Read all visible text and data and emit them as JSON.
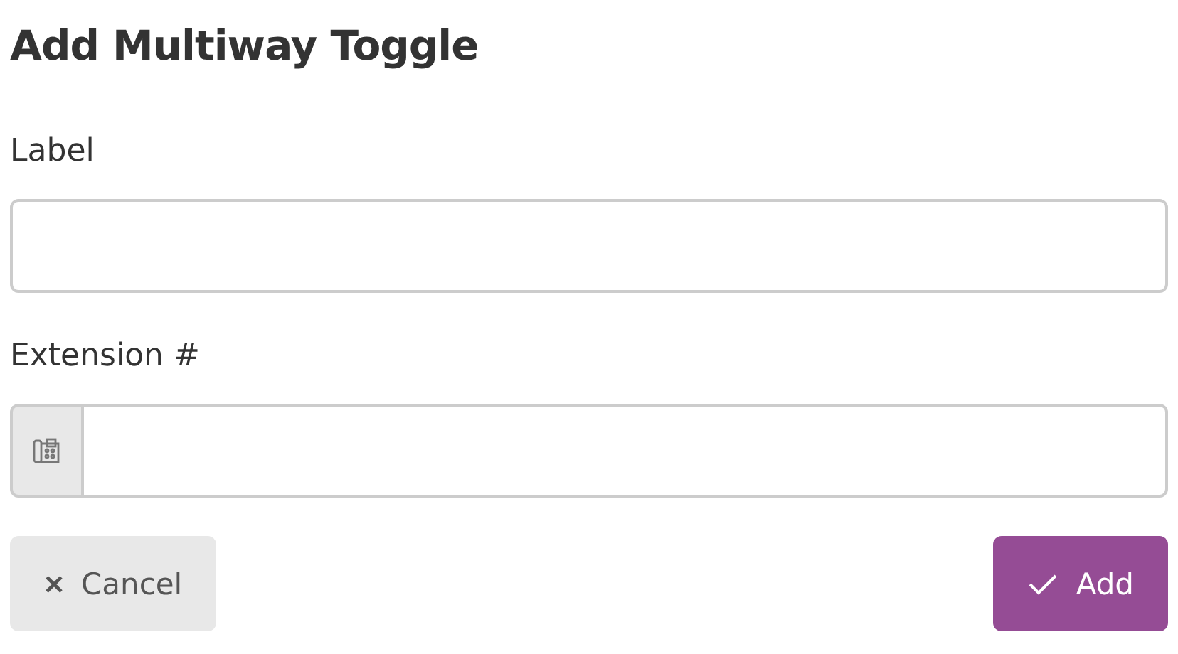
{
  "title": "Add Multiway Toggle",
  "fields": [
    {
      "label": "Label",
      "kind": "text"
    },
    {
      "label": "Extension #",
      "kind": "phone"
    }
  ],
  "buttons": [
    {
      "label": "Cancel",
      "kind": "cancel"
    },
    {
      "label": "Add",
      "kind": "confirm"
    }
  ]
}
